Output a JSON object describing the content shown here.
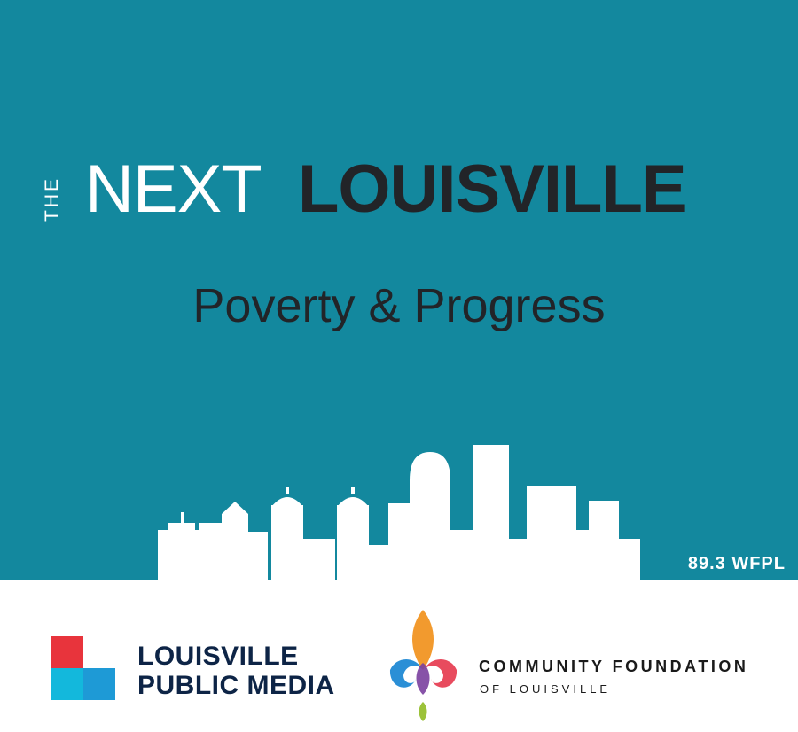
{
  "header": {
    "the_label": "THE",
    "next_label": "NEXT",
    "louisville_label": "LOUISVILLE",
    "subtitle": "Poverty & Progress"
  },
  "station": {
    "label": "89.3 WFPL"
  },
  "sponsors": {
    "lpm": {
      "line1": "LOUISVILLE",
      "line2": "PUBLIC MEDIA",
      "logo_icon": "four-squares-logo-icon"
    },
    "community_foundation": {
      "name": "COMMUNITY FOUNDATION",
      "subname": "OF LOUISVILLE",
      "logo_icon": "fleur-de-lis-logo-icon"
    }
  },
  "colors": {
    "teal": "#13889e",
    "dark_text": "#222428",
    "navy": "#0d2446",
    "lpm_red": "#e8343c",
    "lpm_blue": "#1e9ad6",
    "lpm_cyan": "#13b8dc"
  }
}
